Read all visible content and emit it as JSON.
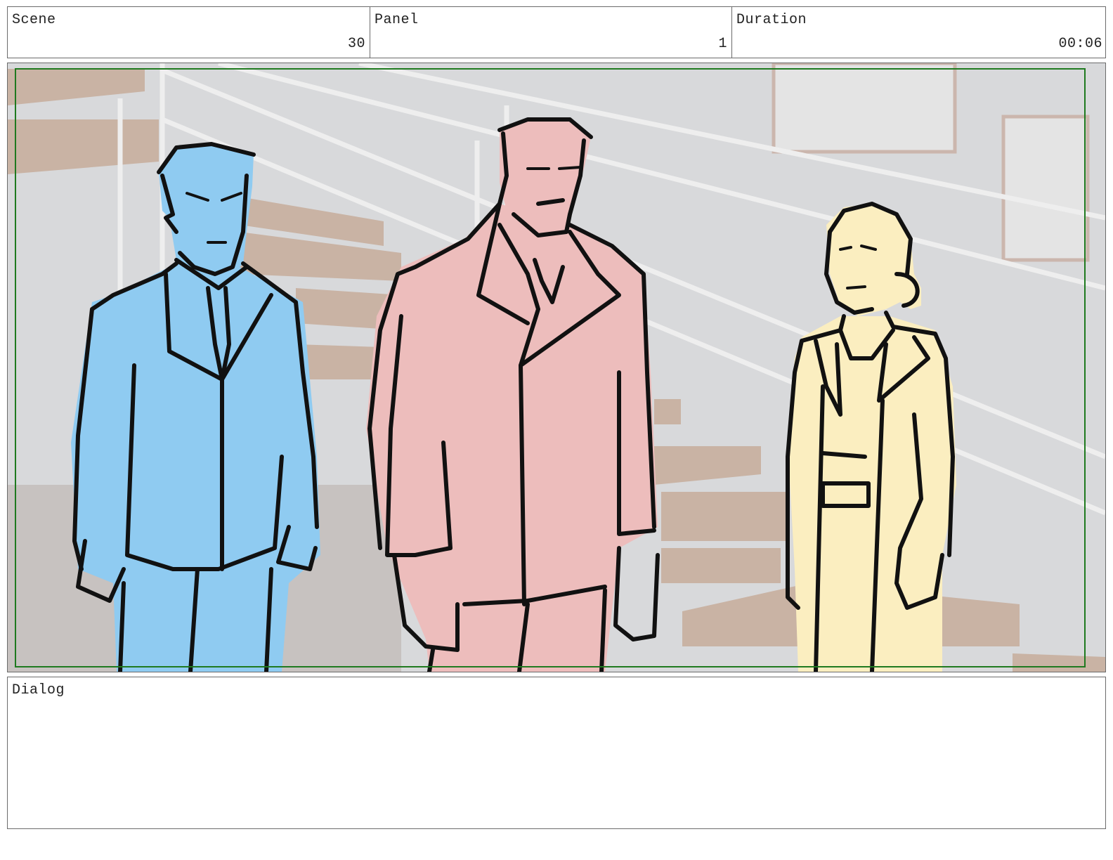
{
  "header": {
    "scene_label": "Scene",
    "scene_value": "30",
    "panel_label": "Panel",
    "panel_value": "1",
    "duration_label": "Duration",
    "duration_value": "00:06"
  },
  "dialog": {
    "label": "Dialog",
    "text": ""
  },
  "colors": {
    "frame_border": "#1f7a1f",
    "figure_left": "#8fcbf1",
    "figure_center": "#edbdbc",
    "figure_right": "#fbeec0",
    "background_wall": "#d7d8da",
    "stairs": "#c9b3a4"
  }
}
